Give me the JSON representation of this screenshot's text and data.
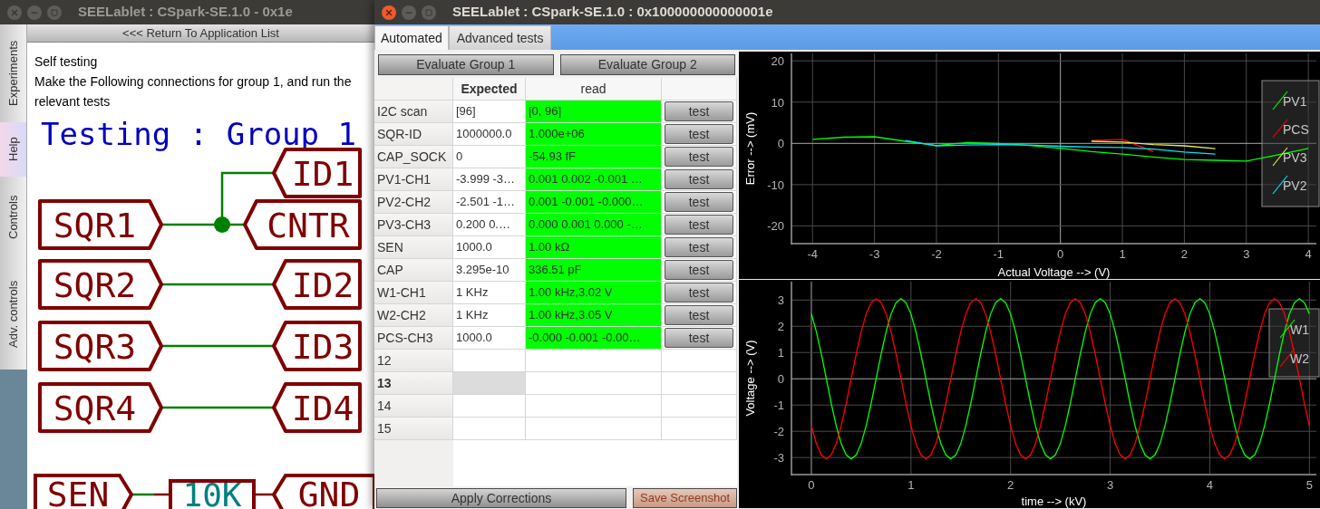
{
  "back_window": {
    "title": "SEELablet : CSpark-SE.1.0 - 0x1e",
    "active": false,
    "side_tabs": [
      {
        "label": "Experiments",
        "selected": false
      },
      {
        "label": "Help",
        "selected": true
      },
      {
        "label": "Controls",
        "selected": false
      },
      {
        "label": "Adv. controls",
        "selected": false
      }
    ],
    "return_button": "<<< Return To Application List",
    "intro": [
      "Self testing",
      "Make the Following connections for group 1, and run the relevant tests"
    ],
    "schematic": {
      "title": "Testing : Group 1",
      "links": [
        {
          "kind": "junction",
          "from": "SQR1",
          "to": "CNTR",
          "branch": "ID1"
        },
        {
          "kind": "wire",
          "from": "SQR2",
          "to": "ID2"
        },
        {
          "kind": "wire",
          "from": "SQR3",
          "to": "ID3"
        },
        {
          "kind": "wire",
          "from": "SQR4",
          "to": "ID4"
        },
        {
          "kind": "resistor",
          "from": "SEN",
          "part": "10K",
          "to": "GND"
        }
      ]
    }
  },
  "front_window": {
    "title": "SEELablet : CSpark-SE.1.0 : 0x100000000000001e",
    "active": true,
    "tabs": [
      {
        "label": "Automated",
        "selected": true
      },
      {
        "label": "Advanced tests",
        "selected": false
      }
    ],
    "group_buttons": [
      "Evaluate Group 1",
      "Evaluate Group 2"
    ],
    "table": {
      "columns": [
        {
          "label": "Expected",
          "selected": true
        },
        {
          "label": "read",
          "selected": false
        }
      ],
      "rows": [
        {
          "label": "I2C scan",
          "expected": "[96]",
          "read": "[0, 96]",
          "pass": true,
          "action": "test",
          "selected": false
        },
        {
          "label": "SQR-ID",
          "expected": "1000000.0",
          "read": "1.000e+06",
          "pass": true,
          "action": "test",
          "selected": false
        },
        {
          "label": "CAP_SOCK",
          "expected": "0",
          "read": "-54.93 fF",
          "pass": true,
          "action": "test",
          "selected": false
        },
        {
          "label": "PV1-CH1",
          "expected": "-3.999 -3…",
          "read": "0.001 0.002 -0.001 …",
          "pass": true,
          "action": "test",
          "selected": false
        },
        {
          "label": "PV2-CH2",
          "expected": "-2.501 -1…",
          "read": "0.001 -0.001 -0.000…",
          "pass": true,
          "action": "test",
          "selected": false
        },
        {
          "label": "PV3-CH3",
          "expected": "0.200 0.…",
          "read": "0.000 0.001 0.000 -…",
          "pass": true,
          "action": "test",
          "selected": false
        },
        {
          "label": "SEN",
          "expected": "1000.0",
          "read": "1.00 kΩ",
          "pass": true,
          "action": "test",
          "selected": false
        },
        {
          "label": "CAP",
          "expected": "3.295e-10",
          "read": "336.51 pF",
          "pass": true,
          "action": "test",
          "selected": false
        },
        {
          "label": "W1-CH1",
          "expected": "1 KHz",
          "read": "1.00 kHz,3.02  V",
          "pass": true,
          "action": "test",
          "selected": false
        },
        {
          "label": "W2-CH2",
          "expected": "1 KHz",
          "read": "1.00 kHz,3.05  V",
          "pass": true,
          "action": "test",
          "selected": false
        },
        {
          "label": "PCS-CH3",
          "expected": "1000.0",
          "read": "-0.000 -0.001 -0.00…",
          "pass": true,
          "action": "test",
          "selected": false
        },
        {
          "label": "12",
          "pass": false,
          "selected": false
        },
        {
          "label": "13",
          "pass": false,
          "selected": true
        },
        {
          "label": "14",
          "pass": false,
          "selected": false
        },
        {
          "label": "15",
          "pass": false,
          "selected": false
        }
      ]
    },
    "apply_button": "Apply Corrections",
    "screenshot_button": "Save Screenshot",
    "charts": [
      {
        "chart_data": {
          "type": "line",
          "xlabel": "Actual Voltage --> (V)",
          "ylabel": "Error --> (mV)",
          "x": [
            -4,
            -3.5,
            -3,
            -2.5,
            -2,
            -1.5,
            -1,
            -0.5,
            0,
            0.5,
            1,
            1.5,
            2,
            2.5,
            3,
            3.5,
            4
          ],
          "series": [
            {
              "name": "PV1",
              "color": "#00ff00",
              "values": [
                1,
                1.5,
                1.6,
                0.5,
                -0.5,
                0.2,
                0,
                -0.5,
                -1.2,
                -2,
                -2.6,
                -3.3,
                -3.9,
                -4.1,
                -4.3,
                -2.8,
                -1.2
              ]
            },
            {
              "name": "PCS",
              "color": "#ff0000",
              "values": [
                null,
                null,
                null,
                null,
                null,
                null,
                null,
                null,
                null,
                0.7,
                1,
                -2,
                null,
                null,
                null,
                null,
                null
              ]
            },
            {
              "name": "PV3",
              "color": "#e8e85a",
              "values": [
                null,
                null,
                null,
                null,
                null,
                null,
                null,
                null,
                null,
                0.5,
                0.3,
                -0.3,
                -0.6,
                -1.3,
                null,
                null,
                null
              ]
            },
            {
              "name": "PV2",
              "color": "#00e5ff",
              "values": [
                null,
                null,
                null,
                0.7,
                -0.6,
                -0.4,
                -0.3,
                -0.4,
                -0.7,
                -0.9,
                -1,
                -1.4,
                -2.1,
                -2.6,
                null,
                null,
                null
              ]
            }
          ],
          "xlim": [
            -4.34,
            4.13
          ],
          "ylim": [
            -24.3,
            21.8
          ],
          "xticks": [
            -4,
            -3,
            -2,
            -1,
            {
              "value": 0,
              "label": "0"
            },
            1,
            2,
            3,
            4
          ],
          "yticks": [
            -20,
            -10,
            {
              "value": 0,
              "label": "0"
            },
            10,
            20
          ],
          "grid": true,
          "legend": true
        }
      },
      {
        "chart_data": {
          "type": "line",
          "xlabel": "time --> (kV)",
          "ylabel": "Voltage --> (V)",
          "x": [
            0,
            0.05,
            0.1,
            0.15,
            0.2,
            0.25,
            0.3,
            0.35,
            0.4,
            0.45,
            0.5,
            0.55,
            0.6,
            0.65,
            0.7,
            0.75,
            0.8,
            0.85,
            0.9,
            0.95,
            1,
            1.05,
            1.1,
            1.15,
            1.2,
            1.25,
            1.3,
            1.35,
            1.4,
            1.45,
            1.5,
            1.55,
            1.6,
            1.65,
            1.7,
            1.75,
            1.8,
            1.85,
            1.9,
            1.95,
            2,
            2.05,
            2.1,
            2.15,
            2.2,
            2.25,
            2.3,
            2.35,
            2.4,
            2.45,
            2.5,
            2.55,
            2.6,
            2.65,
            2.7,
            2.75,
            2.8,
            2.85,
            2.9,
            2.95,
            3,
            3.05,
            3.1,
            3.15,
            3.2,
            3.25,
            3.3,
            3.35,
            3.4,
            3.45,
            3.5,
            3.55,
            3.6,
            3.65,
            3.7,
            3.75,
            3.8,
            3.85,
            3.9,
            3.95,
            4,
            4.05,
            4.1,
            4.15,
            4.2,
            4.25,
            4.3,
            4.35,
            4.4,
            4.45,
            4.5,
            4.55,
            4.6,
            4.65,
            4.7,
            4.75,
            4.8,
            4.85,
            4.9,
            4.95,
            5
          ],
          "series": [
            {
              "name": "W1",
              "color": "#00ff00",
              "values": [
                2.47,
                1.79,
                0.94,
                0,
                -0.94,
                -1.79,
                -2.47,
                -2.9,
                -3.05,
                -2.9,
                -2.47,
                -1.79,
                -0.94,
                0,
                0.94,
                1.79,
                2.47,
                2.9,
                3.05,
                2.9,
                2.47,
                1.79,
                0.94,
                0,
                -0.94,
                -1.79,
                -2.47,
                -2.9,
                -3.05,
                -2.9,
                -2.47,
                -1.79,
                -0.94,
                0,
                0.94,
                1.79,
                2.47,
                2.9,
                3.05,
                2.9,
                2.47,
                1.79,
                0.94,
                0,
                -0.94,
                -1.79,
                -2.47,
                -2.9,
                -3.05,
                -2.9,
                -2.47,
                -1.79,
                -0.94,
                0,
                0.94,
                1.79,
                2.47,
                2.9,
                3.05,
                2.9,
                2.47,
                1.79,
                0.94,
                0,
                -0.94,
                -1.79,
                -2.47,
                -2.9,
                -3.05,
                -2.9,
                -2.47,
                -1.79,
                -0.94,
                0,
                0.94,
                1.79,
                2.47,
                2.9,
                3.05,
                2.9,
                2.47,
                1.79,
                0.94,
                0,
                -0.94,
                -1.79,
                -2.47,
                -2.9,
                -3.05,
                -2.9,
                -2.47,
                -1.79,
                -0.94,
                0,
                0.94,
                1.79,
                2.47,
                2.9,
                3.05,
                2.9,
                2.47
              ]
            },
            {
              "name": "W2",
              "color": "#ff0000",
              "values": [
                -1.79,
                -2.47,
                -2.9,
                -3.05,
                -2.9,
                -2.47,
                -1.79,
                -0.94,
                0,
                0.94,
                1.79,
                2.47,
                2.9,
                3.05,
                2.9,
                2.47,
                1.79,
                0.94,
                0,
                -0.94,
                -1.79,
                -2.47,
                -2.9,
                -3.05,
                -2.9,
                -2.47,
                -1.79,
                -0.94,
                0,
                0.94,
                1.79,
                2.47,
                2.9,
                3.05,
                2.9,
                2.47,
                1.79,
                0.94,
                0,
                -0.94,
                -1.79,
                -2.47,
                -2.9,
                -3.05,
                -2.9,
                -2.47,
                -1.79,
                -0.94,
                0,
                0.94,
                1.79,
                2.47,
                2.9,
                3.05,
                2.9,
                2.47,
                1.79,
                0.94,
                0,
                -0.94,
                -1.79,
                -2.47,
                -2.9,
                -3.05,
                -2.9,
                -2.47,
                -1.79,
                -0.94,
                0,
                0.94,
                1.79,
                2.47,
                2.9,
                3.05,
                2.9,
                2.47,
                1.79,
                0.94,
                0,
                -0.94,
                -1.79,
                -2.47,
                -2.9,
                -3.05,
                -2.9,
                -2.47,
                -1.79,
                -0.94,
                0,
                0.94,
                1.79,
                2.47,
                2.9,
                3.05,
                2.9,
                2.47,
                1.79,
                0.94,
                0,
                -0.94,
                -1.79
              ]
            }
          ],
          "xlim": [
            -0.2,
            5.07
          ],
          "ylim": [
            -3.65,
            3.7
          ],
          "xticks": [
            {
              "value": 0,
              "label": "0"
            },
            1,
            2,
            3,
            4,
            5
          ],
          "yticks": [
            -3,
            -2,
            -1,
            {
              "value": 0,
              "label": "0"
            },
            1,
            2,
            3
          ],
          "grid": true,
          "legend": true
        }
      }
    ]
  }
}
